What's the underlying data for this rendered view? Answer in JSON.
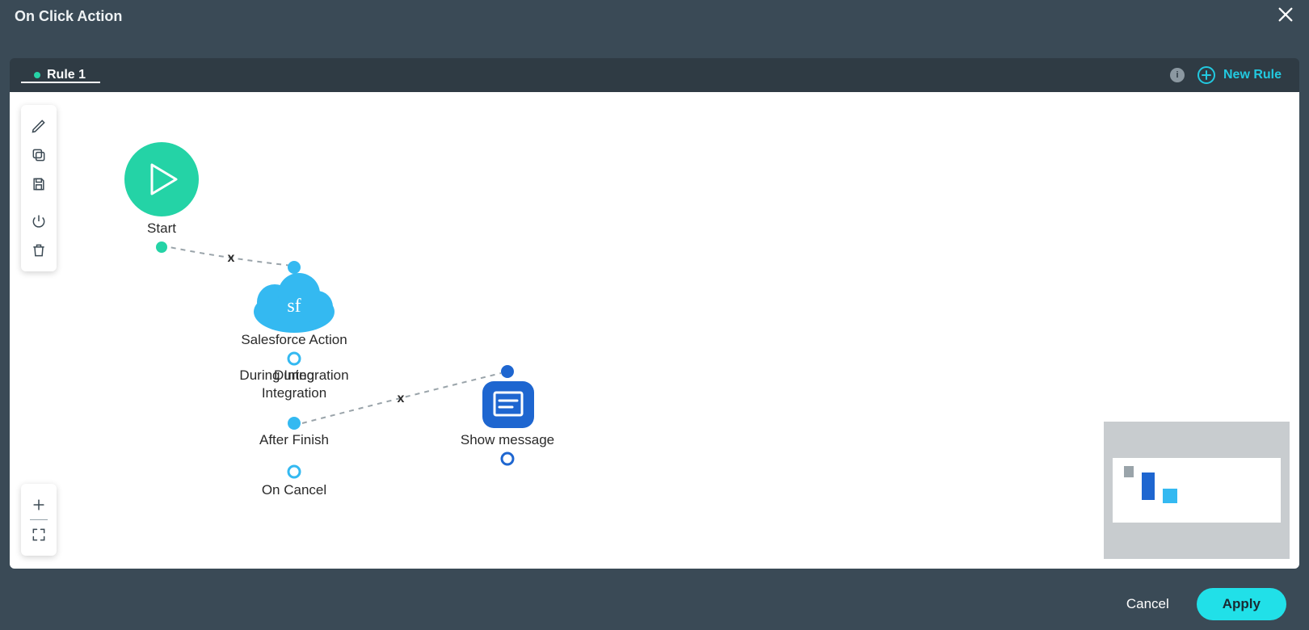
{
  "colors": {
    "accent_teal": "#24d3a6",
    "accent_cyan": "#21e0e8",
    "sky": "#34b9f1",
    "royal": "#1e66d0",
    "dark": "#3a4a56"
  },
  "titlebar": {
    "title": "On Click Action"
  },
  "tabs": {
    "active": "Rule 1",
    "new_label": "New Rule"
  },
  "toolbox_top": [
    {
      "name": "edit",
      "icon": "pencil"
    },
    {
      "name": "copy",
      "icon": "copy"
    },
    {
      "name": "save",
      "icon": "save"
    },
    {
      "name": "power",
      "icon": "power"
    },
    {
      "name": "delete",
      "icon": "trash"
    }
  ],
  "toolbox_bottom": [
    {
      "name": "zoom-in",
      "icon": "plus"
    },
    {
      "name": "fullscreen",
      "icon": "fullscreen"
    }
  ],
  "nodes": {
    "start": {
      "label": "Start"
    },
    "salesforce": {
      "label": "Salesforce Action",
      "glyph": "sf",
      "outlets": [
        "During Integration",
        "After Finish",
        "On Cancel"
      ]
    },
    "message": {
      "label": "Show message"
    }
  },
  "edges": [
    {
      "from": "start",
      "to": "salesforce",
      "deletable": true
    },
    {
      "from": "salesforce.after_finish",
      "to": "message",
      "deletable": true
    }
  ],
  "footer": {
    "cancel": "Cancel",
    "apply": "Apply"
  }
}
